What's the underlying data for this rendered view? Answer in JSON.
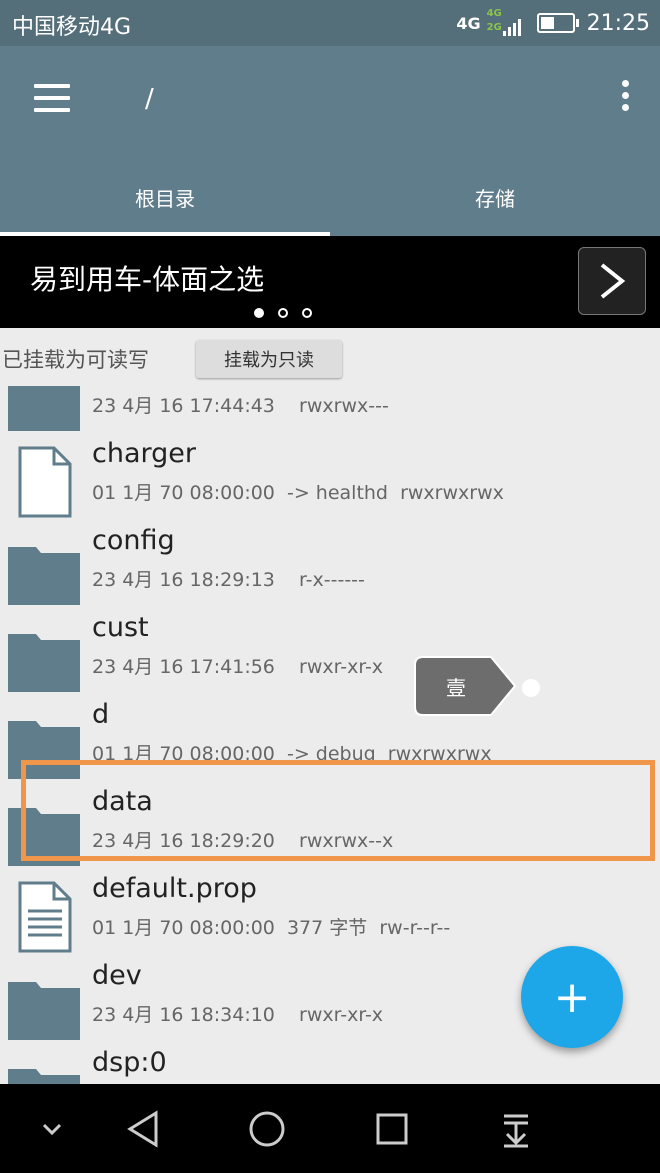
{
  "status": {
    "carrier": "中国移动4G",
    "network": "4G",
    "sig_top": "4G",
    "sig_bottom": "2G",
    "battery_level": 0.45,
    "time": "21:25"
  },
  "appbar": {
    "path": "/",
    "tabs": [
      {
        "label": "根目录"
      },
      {
        "label": "存储"
      }
    ]
  },
  "banner": {
    "text": "易到用车-体面之选",
    "slides": 3,
    "active_slide": 0
  },
  "mount": {
    "label": "已挂载为可读写",
    "button": "挂载为只读"
  },
  "files": [
    {
      "name": "",
      "meta": "23 4月 16 17:44:43    rwxrwx---",
      "icon": "folder-icon"
    },
    {
      "name": "charger",
      "meta": "01 1月 70 08:00:00  -> healthd  rwxrwxrwx",
      "icon": "file-icon"
    },
    {
      "name": "config",
      "meta": "23 4月 16 18:29:13    r-x------",
      "icon": "folder-icon"
    },
    {
      "name": "cust",
      "meta": "23 4月 16 17:41:56    rwxr-xr-x",
      "icon": "folder-icon"
    },
    {
      "name": "d",
      "meta": "01 1月 70 08:00:00  -> debug  rwxrwxrwx",
      "icon": "folder-icon"
    },
    {
      "name": "data",
      "meta": "23 4月 16 18:29:20    rwxrwx--x",
      "icon": "folder-icon"
    },
    {
      "name": "default.prop",
      "meta": "01 1月 70 08:00:00  377 字节  rw-r--r--",
      "icon": "text-file-icon"
    },
    {
      "name": "dev",
      "meta": "23 4月 16 18:34:10    rwxr-xr-x",
      "icon": "folder-icon"
    },
    {
      "name": "dsp:0",
      "meta": "",
      "icon": "folder-icon"
    }
  ],
  "tooltip": {
    "label": "壹"
  },
  "fab": {
    "label": "+"
  },
  "colors": {
    "appbar": "#607d8b",
    "statusbar": "#546e7a",
    "fab": "#1ea7e8",
    "highlight": "#f0964a",
    "folder": "#607d8b"
  }
}
